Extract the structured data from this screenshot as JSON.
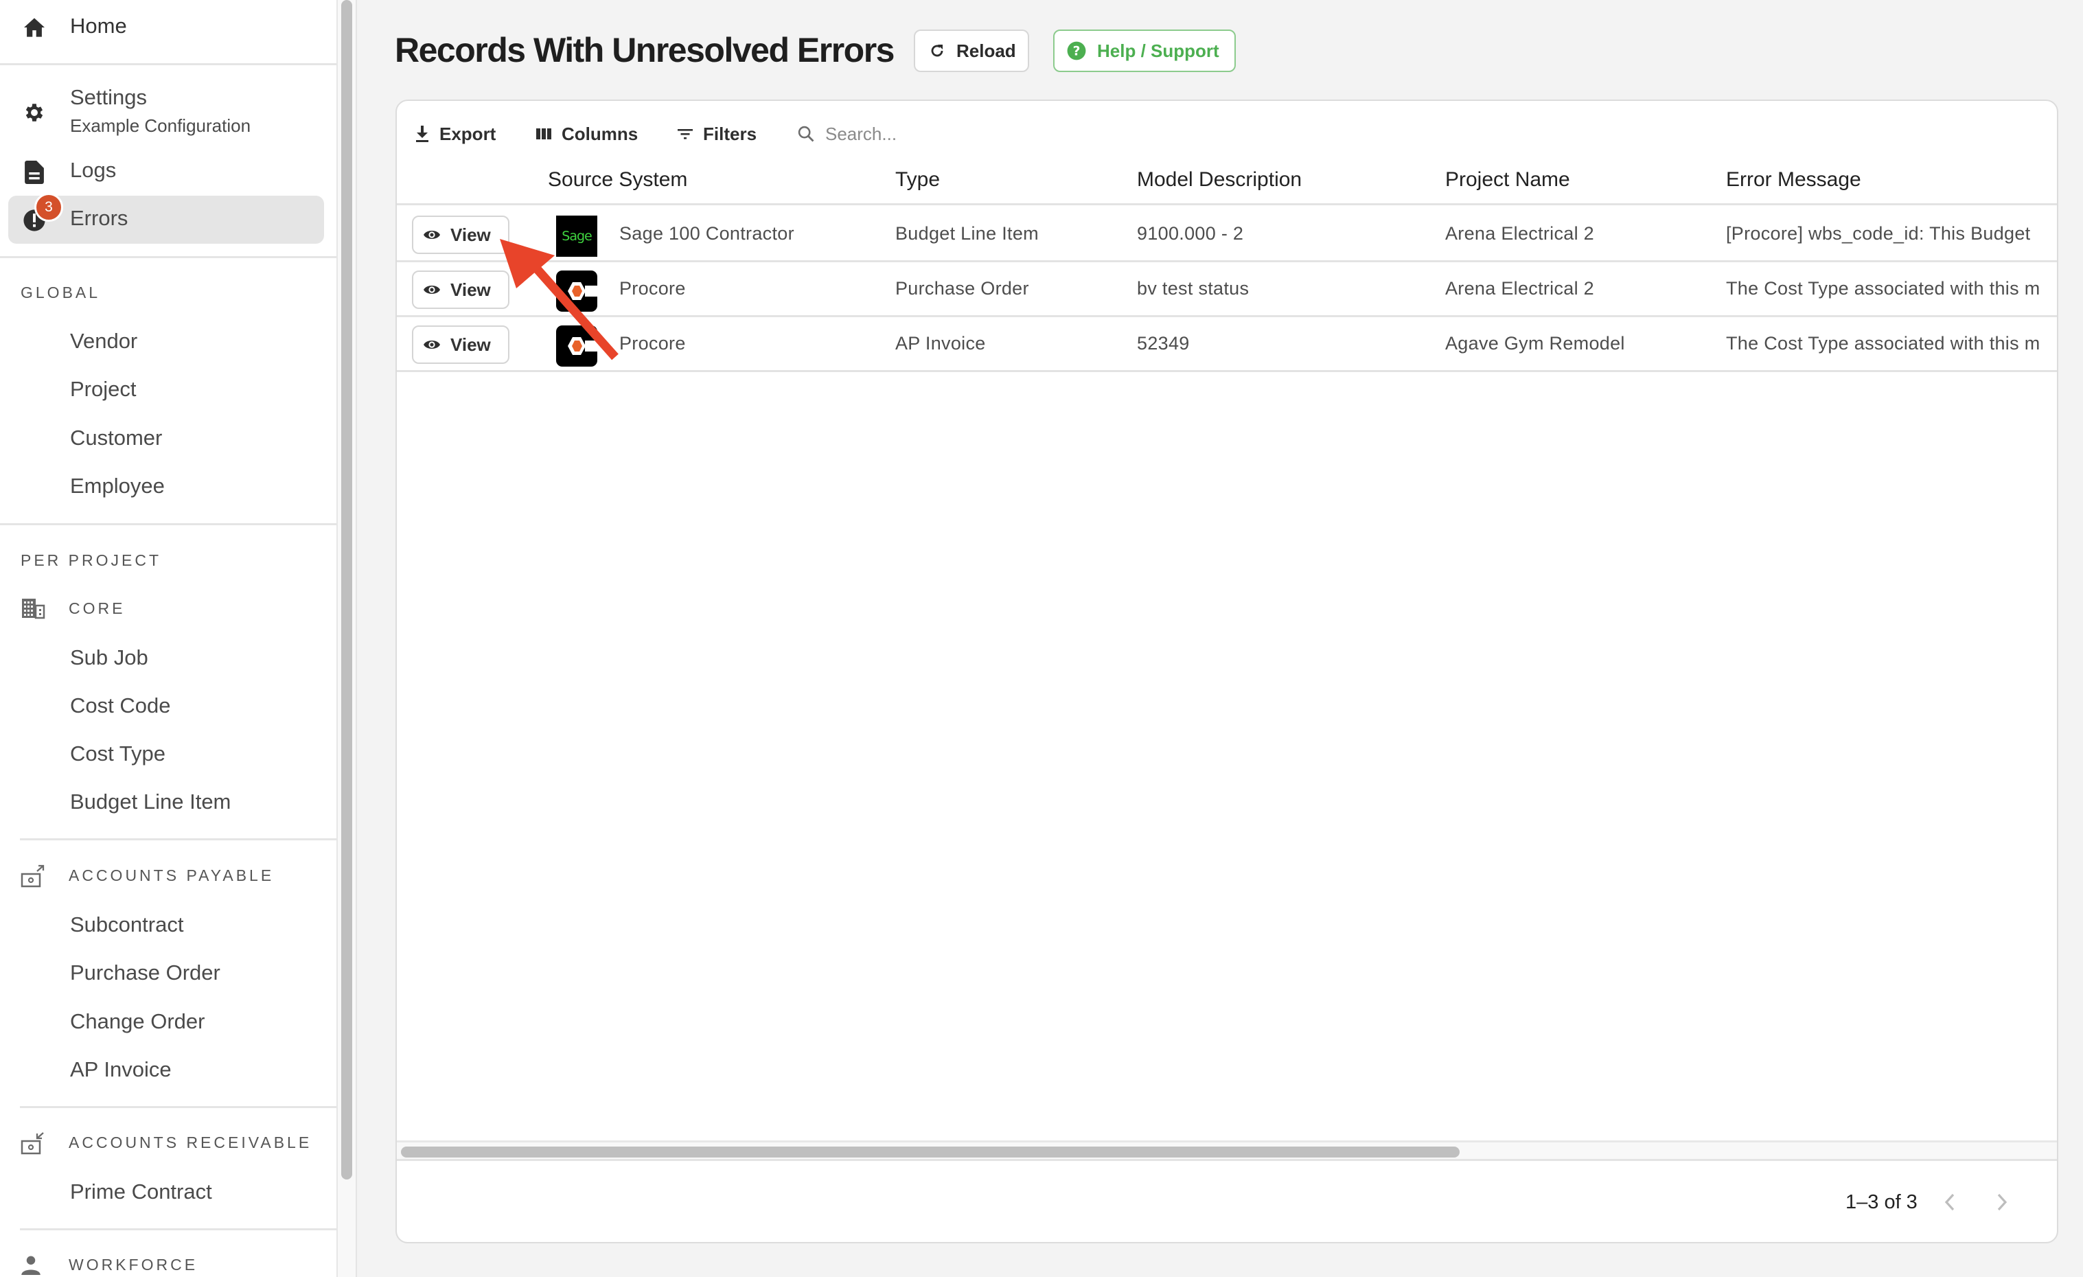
{
  "sidebar": {
    "home": {
      "label": "Home",
      "icon": "home-icon"
    },
    "settings": {
      "label": "Settings",
      "sublabel": "Example Configuration",
      "icon": "gear-icon"
    },
    "logs": {
      "label": "Logs",
      "icon": "document-icon"
    },
    "errors": {
      "label": "Errors",
      "icon": "error-icon",
      "badge": "3",
      "active": true
    },
    "sections": {
      "global": {
        "title": "GLOBAL",
        "items": [
          "Vendor",
          "Project",
          "Customer",
          "Employee"
        ]
      },
      "per_project": {
        "title": "PER PROJECT",
        "groups": {
          "core": {
            "title": "CORE",
            "icon": "building-icon",
            "items": [
              "Sub Job",
              "Cost Code",
              "Cost Type",
              "Budget Line Item"
            ]
          },
          "accounts_payable": {
            "title": "ACCOUNTS PAYABLE",
            "icon": "money-out-icon",
            "items": [
              "Subcontract",
              "Purchase Order",
              "Change Order",
              "AP Invoice"
            ]
          },
          "accounts_receivable": {
            "title": "ACCOUNTS RECEIVABLE",
            "icon": "money-in-icon",
            "items": [
              "Prime Contract"
            ]
          },
          "workforce": {
            "title": "WORKFORCE",
            "icon": "person-icon",
            "items": []
          }
        }
      }
    }
  },
  "header": {
    "title": "Records With Unresolved Errors",
    "reload_label": "Reload",
    "help_label": "Help / Support"
  },
  "toolbar": {
    "export_label": "Export",
    "columns_label": "Columns",
    "filters_label": "Filters",
    "search_placeholder": "Search...",
    "search_value": ""
  },
  "table": {
    "columns": [
      "",
      "Source System",
      "Type",
      "Model Description",
      "Project Name",
      "Error Message"
    ],
    "rows": [
      {
        "action": "View",
        "source_logo": "sage",
        "source": "Sage 100 Contractor",
        "type": "Budget Line Item",
        "model": "9100.000 - 2",
        "project": "Arena Electrical 2",
        "error": "[Procore] wbs_code_id: This Budget"
      },
      {
        "action": "View",
        "source_logo": "procore",
        "source": "Procore",
        "type": "Purchase Order",
        "model": "bv test status",
        "project": "Arena Electrical 2",
        "error": "The Cost Type associated with this m"
      },
      {
        "action": "View",
        "source_logo": "procore",
        "source": "Procore",
        "type": "AP Invoice",
        "model": "52349",
        "project": "Agave Gym Remodel",
        "error": "The Cost Type associated with this m"
      }
    ]
  },
  "pagination": {
    "text": "1–3 of 3",
    "prev_enabled": false,
    "next_enabled": false
  },
  "colors": {
    "badge": "#d4502a",
    "help_green": "#4caf50",
    "procore_orange": "#e8622a",
    "sage_green": "#3fd33f",
    "annotation_arrow": "#e8442a"
  }
}
